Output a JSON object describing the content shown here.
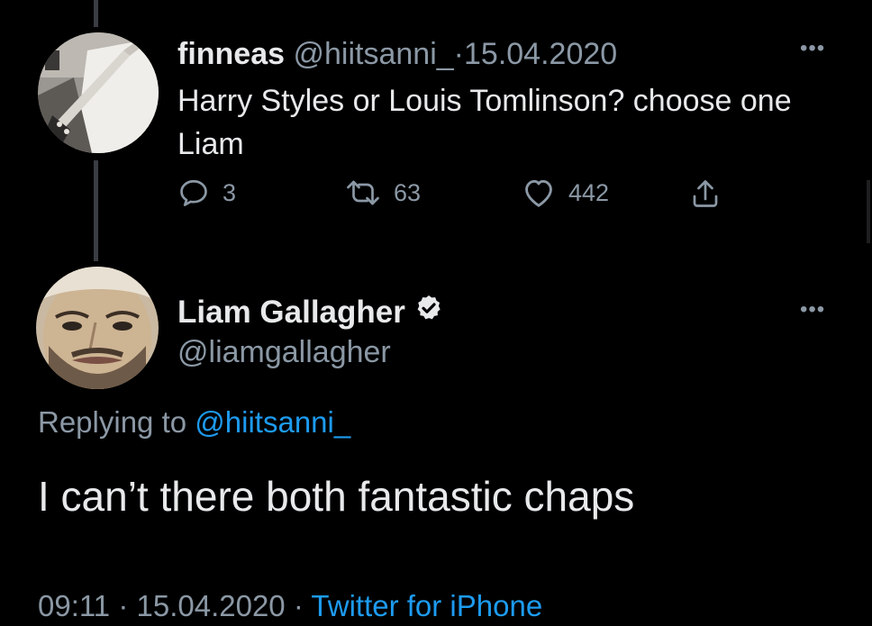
{
  "tweet1": {
    "name": "finneas",
    "handle": "@hiitsanni_",
    "separator": "·",
    "date": "15.04.2020",
    "text": "Harry Styles or Louis Tomlinson?  choose one Liam",
    "more_icon": "more-horizontal-icon",
    "actions": {
      "reply_icon": "reply-icon",
      "reply_count": "3",
      "retweet_icon": "retweet-icon",
      "retweet_count": "63",
      "like_icon": "heart-icon",
      "like_count": "442",
      "share_icon": "share-icon"
    }
  },
  "tweet2": {
    "name": "Liam Gallagher",
    "verified_icon": "verified-badge-icon",
    "handle": "@liamgallagher",
    "more_icon": "more-horizontal-icon",
    "replying_prefix": "Replying to",
    "replying_to": "@hiitsanni_",
    "text": "I can’t there both fantastic chaps",
    "time": "09:11",
    "separator": "·",
    "date": "15.04.2020",
    "source": "Twitter for iPhone"
  },
  "colors": {
    "background": "#000000",
    "text": "#e7e9ea",
    "secondary": "#8b98a5",
    "link": "#1d9bf0",
    "thread_line": "#3a3d41"
  }
}
